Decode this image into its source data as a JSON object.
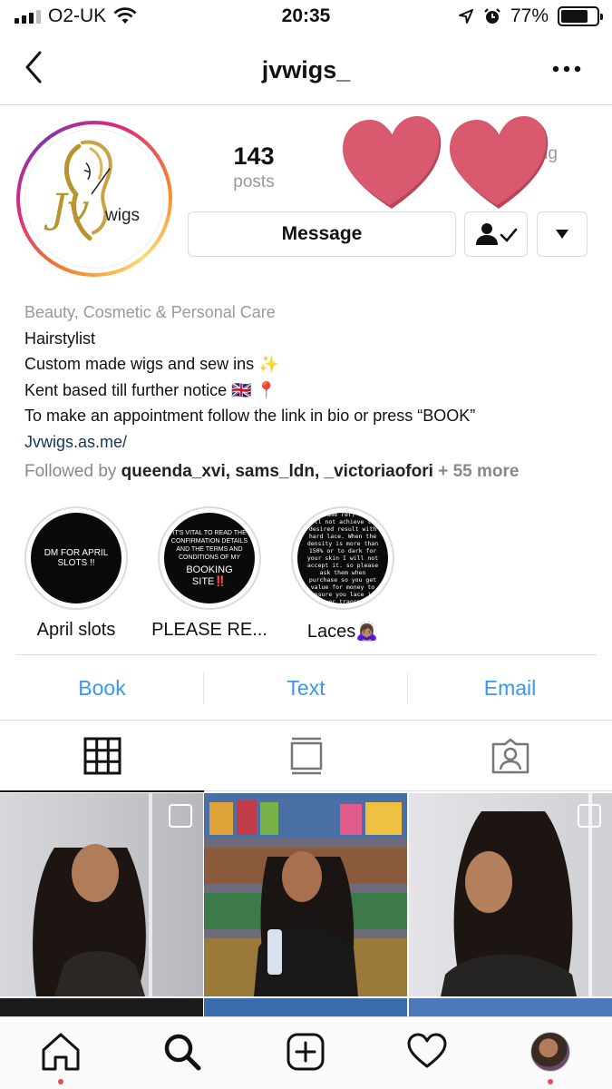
{
  "status_bar": {
    "carrier": "O2-UK",
    "time": "20:35",
    "battery": "77%",
    "battery_level": 0.77
  },
  "header": {
    "title": "jvwigs_"
  },
  "profile": {
    "logo_main": "Jv",
    "logo_sub": "wigs",
    "stats": [
      {
        "value": "143",
        "label": "posts"
      },
      {
        "value": "",
        "label": "fo"
      },
      {
        "value": "",
        "label": "ng"
      }
    ],
    "message_button": "Message",
    "bio": {
      "category": "Beauty, Cosmetic & Personal Care",
      "lines": [
        "Hairstylist",
        "Custom made wigs and sew ins ✨",
        "Kent based till further notice 🇬🇧 📍",
        "To make an appointment follow the link in bio or press “BOOK”"
      ],
      "link": "Jvwigs.as.me/",
      "followed_prefix": "Followed by ",
      "followed_names": "queenda_xvi, sams_ldn, _victoriaofori",
      "followed_more": " + 55 more"
    }
  },
  "highlights": [
    {
      "label": "April slots",
      "cover_text": "DM FOR APRIL SLOTS !!"
    },
    {
      "label": "PLEASE RE...",
      "cover_text": "IT'S VITAL TO READ THE CONFIRMATION DETAILS AND THE TERMS AND CONDITIONS OF MY",
      "cover_emphasis": "BOOKING SITE‼️"
    },
    {
      "label": "Laces🙇🏽‍♀️",
      "cover_text": "density lace is hard like same rer) as you will not achieve the desired result with hard lace. When the density is more than 150% or to dark for your skin I will not accept it. so please ask them when purchase so you get value for money to ensure you lace is light or transparent the lace is"
    }
  ],
  "contact_buttons": [
    "Book",
    "Text",
    "Email"
  ],
  "colors": {
    "accent_blue": "#3897f0",
    "link_navy": "#10385e",
    "hearts": "#d95a6e",
    "notification_dot": "#ed4956"
  },
  "icons": {
    "grid_tab": "grid-icon",
    "feed_tab": "feed-icon",
    "tagged_tab": "tagged-icon",
    "nav": [
      "home-icon",
      "search-icon",
      "add-post-icon",
      "activity-heart-icon",
      "profile-avatar"
    ]
  }
}
